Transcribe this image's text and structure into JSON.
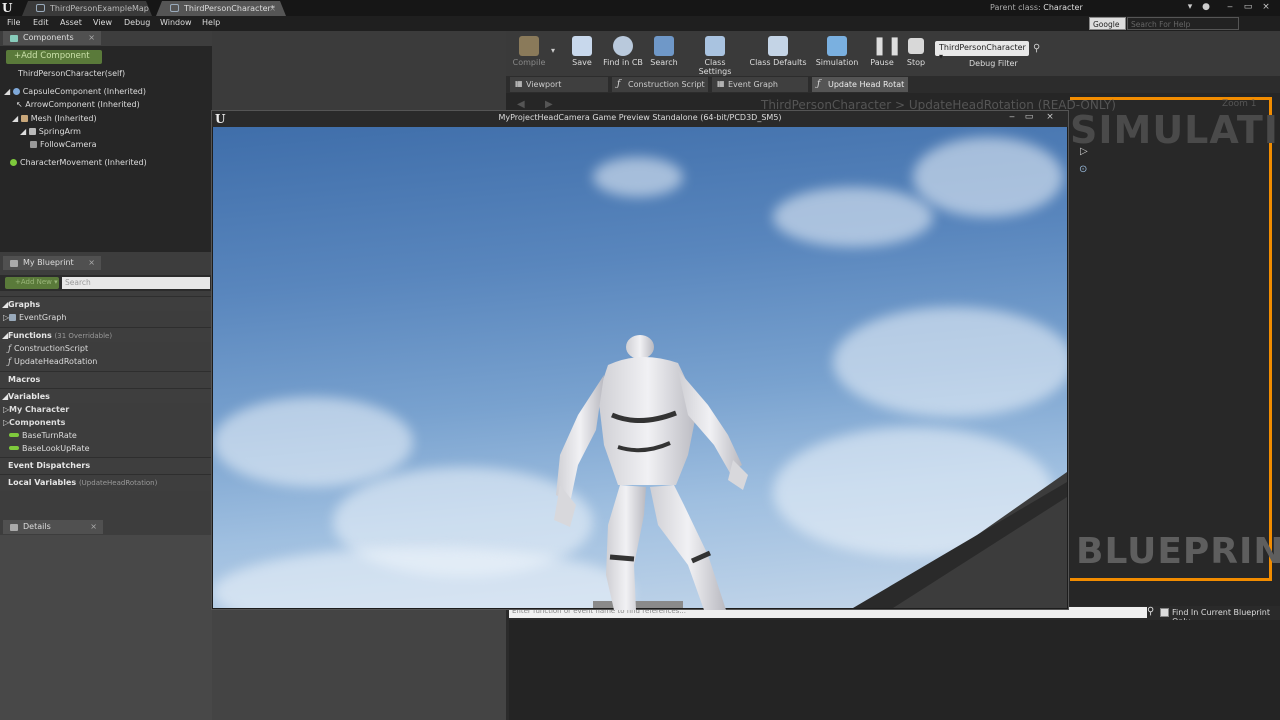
{
  "tabs": [
    {
      "label": "ThirdPersonExampleMap*"
    },
    {
      "label": "ThirdPersonCharacter*"
    }
  ],
  "parent_class": {
    "label": "Parent class:",
    "value": "Character"
  },
  "help_search": {
    "engine": "Google",
    "placeholder": "Search For Help"
  },
  "menu": [
    "File",
    "Edit",
    "Asset",
    "View",
    "Debug",
    "Window",
    "Help"
  ],
  "components_panel": {
    "title": "Components",
    "add_button": "+Add Component",
    "items": [
      "ThirdPersonCharacter(self)",
      "CapsuleComponent (Inherited)",
      "ArrowComponent (Inherited)",
      "Mesh (Inherited)",
      "SpringArm",
      "FollowCamera",
      "CharacterMovement (Inherited)"
    ]
  },
  "my_blueprint": {
    "title": "My Blueprint",
    "add_new": "+Add New",
    "search_placeholder": "Search",
    "graphs": {
      "header": "Graphs",
      "items": [
        "EventGraph"
      ]
    },
    "functions": {
      "header": "Functions",
      "sub": "(31 Overridable)",
      "items": [
        "ConstructionScript",
        "UpdateHeadRotation"
      ]
    },
    "macros": {
      "header": "Macros"
    },
    "variables": {
      "header": "Variables",
      "groups": [
        "My Character",
        "Components"
      ],
      "items": [
        "BaseTurnRate",
        "BaseLookUpRate"
      ]
    },
    "event_dispatchers": {
      "header": "Event Dispatchers"
    },
    "local_variables": {
      "header": "Local Variables",
      "sub": "(UpdateHeadRotation)"
    }
  },
  "details_panel": {
    "title": "Details"
  },
  "toolbar": {
    "compile": "Compile",
    "save": "Save",
    "find_in_cb": "Find in CB",
    "search": "Search",
    "class_settings": "Class Settings",
    "class_defaults": "Class Defaults",
    "simulation": "Simulation",
    "pause": "Pause",
    "stop": "Stop",
    "debug_filter_value": "ThirdPersonCharacter",
    "debug_filter_label": "Debug Filter"
  },
  "graph_tabs": [
    "Viewport",
    "Construction Script",
    "Event Graph",
    "Update Head Rotat"
  ],
  "graph": {
    "breadcrumb": "ThirdPersonCharacter > UpdateHeadRotation (READ-ONLY)",
    "zoom": "Zoom 1",
    "simulating": "SIMULATING",
    "watermark": "BLUEPRINT"
  },
  "find_results": {
    "placeholder": "Enter function or event name to find references...",
    "checkbox_label": "Find In Current Blueprint Only"
  },
  "game_window": {
    "title": "MyProjectHeadCamera Game Preview Standalone (64-bit/PCD3D_SM5)"
  },
  "colors": {
    "accent_orange": "#f28c00",
    "add_green": "#5a7a3a",
    "variable_green": "#7ec93c"
  }
}
